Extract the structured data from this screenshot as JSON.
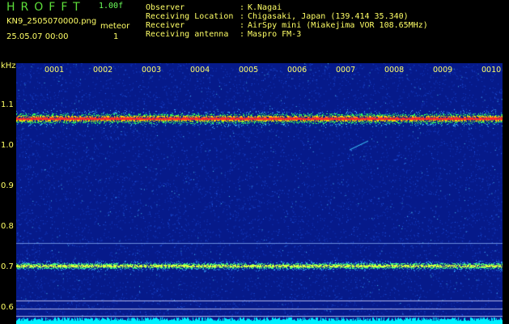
{
  "app": {
    "title": "HROFFT",
    "version": "1.00f",
    "file": "KN9_2505070000.png",
    "mode_label": "meteor",
    "datetime": "25.05.07 00:00",
    "mode_value": "1"
  },
  "info": [
    {
      "key": "Observer",
      "value": "K.Nagai"
    },
    {
      "key": "Receiving Location",
      "value": "Chigasaki, Japan (139.414 35.340)"
    },
    {
      "key": "Receiver",
      "value": "AirSpy mini (Miakejima VOR 108.65MHz)"
    },
    {
      "key": "Receiving antenna",
      "value": "Maspro FM-3"
    }
  ],
  "colors": {
    "background": "#000000",
    "plot_bg": "#061a8a",
    "label": "#ffff66",
    "title": "#5ddf3a"
  },
  "axis": {
    "y_unit": "kHz",
    "y_ticks": [
      "1.1",
      "1.0",
      "0.9",
      "0.8",
      "0.7",
      "0.6"
    ],
    "x_ticks": [
      "0001",
      "0002",
      "0003",
      "0004",
      "0005",
      "0006",
      "0007",
      "0008",
      "0009",
      "0010"
    ]
  }
}
